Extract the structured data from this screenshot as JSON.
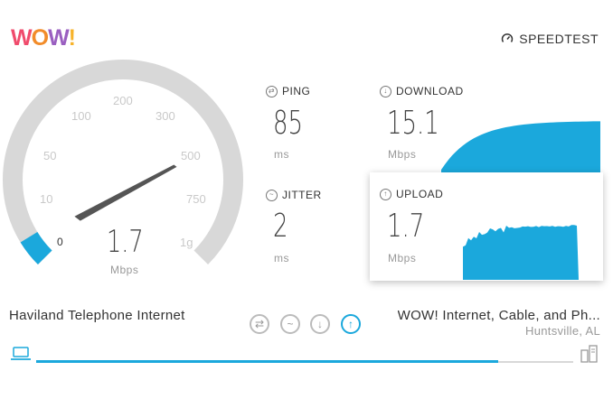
{
  "header": {
    "logo": [
      "W",
      "O",
      "W",
      "!"
    ],
    "speedtest_label": "SPEEDTEST"
  },
  "gauge": {
    "scale_labels": [
      "0",
      "10",
      "50",
      "100",
      "200",
      "300",
      "500",
      "750",
      "1g"
    ],
    "value": "1.7",
    "unit": "Mbps",
    "fill_fraction": 0.05
  },
  "ping": {
    "label": "PING",
    "value": "85",
    "unit": "ms"
  },
  "jitter": {
    "label": "JITTER",
    "value": "2",
    "unit": "ms"
  },
  "download": {
    "label": "DOWNLOAD",
    "value": "15.1",
    "unit": "Mbps"
  },
  "upload": {
    "label": "UPLOAD",
    "value": "1.7",
    "unit": "Mbps"
  },
  "isp": {
    "name": "Haviland Telephone Internet"
  },
  "server": {
    "name": "WOW! Internet, Cable, and Ph...",
    "location": "Huntsville, AL"
  },
  "steps": [
    "ping-step",
    "jitter-step",
    "download-step",
    "upload-step"
  ],
  "progress": {
    "fraction": 0.86
  },
  "colors": {
    "accent": "#1ba8dc",
    "gauge_track": "#d8d8d8"
  }
}
